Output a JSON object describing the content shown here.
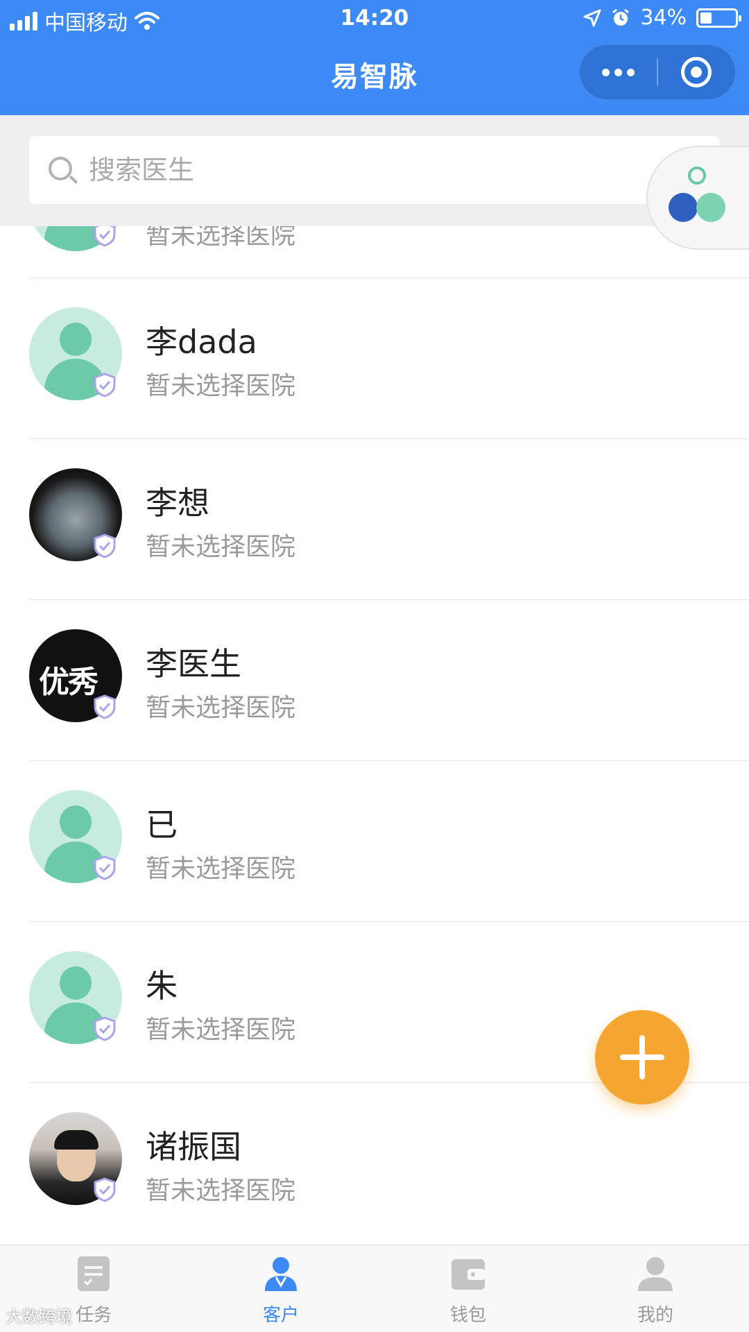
{
  "status_bar": {
    "carrier": "中国移动",
    "time": "14:20",
    "battery_percent_label": "34%",
    "battery_level": 0.34
  },
  "header": {
    "title": "易智脉"
  },
  "search": {
    "placeholder": "搜索医生"
  },
  "doctors": [
    {
      "name": "",
      "hospital": "暂未选择医院",
      "avatar": "default",
      "partial": true
    },
    {
      "name": "李dada",
      "hospital": "暂未选择医院",
      "avatar": "default"
    },
    {
      "name": "李想",
      "hospital": "暂未选择医院",
      "avatar": "photo-magnifier"
    },
    {
      "name": "李医生",
      "hospital": "暂未选择医院",
      "avatar": "photo-text",
      "avatar_text": "优秀"
    },
    {
      "name": "已",
      "hospital": "暂未选择医院",
      "avatar": "default"
    },
    {
      "name": "朱",
      "hospital": "暂未选择医院",
      "avatar": "default"
    },
    {
      "name": "诸振国",
      "hospital": "暂未选择医院",
      "avatar": "photo-person"
    }
  ],
  "tabbar": [
    {
      "label": "任务",
      "icon": "task-list-icon",
      "active": false
    },
    {
      "label": "客户",
      "icon": "doctor-icon",
      "active": true
    },
    {
      "label": "钱包",
      "icon": "wallet-icon",
      "active": false
    },
    {
      "label": "我的",
      "icon": "profile-icon",
      "active": false
    }
  ],
  "colors": {
    "primary": "#3d8af7",
    "fab": "#f5a632",
    "avatar_default": "#6ccaa9",
    "verify": "#a9a3e8"
  },
  "watermark": "大数跨境"
}
